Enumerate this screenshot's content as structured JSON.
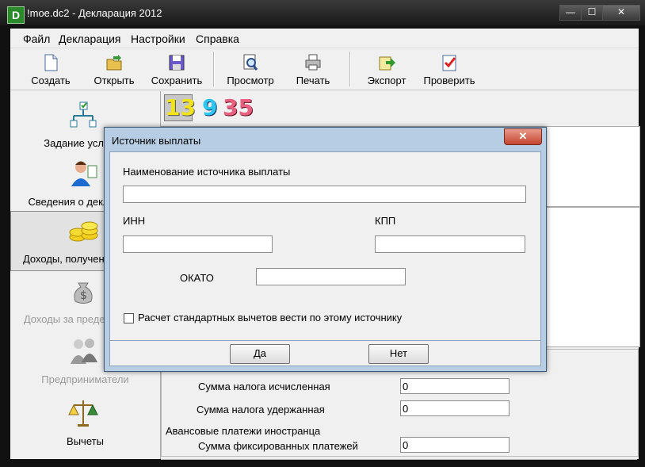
{
  "window": {
    "title": "!moe.dc2 - Декларация 2012",
    "app_icon_letter": "D",
    "min": "—",
    "max": "☐",
    "close": "✕"
  },
  "menu": [
    "Файл",
    "Декларация",
    "Настройки",
    "Справка"
  ],
  "toolbar": [
    {
      "label": "Создать",
      "icon": "new-document-icon"
    },
    {
      "label": "Открыть",
      "icon": "open-folder-icon"
    },
    {
      "label": "Сохранить",
      "icon": "floppy-disk-icon"
    },
    {
      "label": "Просмотр",
      "icon": "magnifier-icon"
    },
    {
      "label": "Печать",
      "icon": "printer-icon"
    },
    {
      "label": "Экспорт",
      "icon": "export-icon"
    },
    {
      "label": "Проверить",
      "icon": "checklist-icon"
    }
  ],
  "sidebar": [
    {
      "label": "Задание условий",
      "icon": "tree-diagram-icon",
      "active": false,
      "disabled": false
    },
    {
      "label": "Сведения о декларанте",
      "icon": "person-icon",
      "active": false,
      "disabled": false
    },
    {
      "label": "Доходы, полученные в РФ",
      "icon": "coins-icon",
      "active": true,
      "disabled": false
    },
    {
      "label": "Доходы за пределами РФ",
      "icon": "money-bag-icon",
      "active": false,
      "disabled": true
    },
    {
      "label": "Предприниматели",
      "icon": "businessmen-icon",
      "active": false,
      "disabled": true
    },
    {
      "label": "Вычеты",
      "icon": "scales-icon",
      "active": false,
      "disabled": false
    }
  ],
  "tax_rates": {
    "r13": "13",
    "r9": "9",
    "r35": "35"
  },
  "content": {
    "sum_calculated_label": "Сумма налога исчисленная",
    "sum_calculated_value": "0",
    "sum_withheld_label": "Сумма налога удержанная",
    "sum_withheld_value": "0",
    "advance_group_title": "Авансовые платежи иностранца",
    "fixed_payments_label": "Сумма фиксированных платежей",
    "fixed_payments_value": "0"
  },
  "dialog": {
    "title": "Источник выплаты",
    "close": "✕",
    "name_label": "Наименование источника выплаты",
    "name_value": "",
    "inn_label": "ИНН",
    "inn_value": "",
    "kpp_label": "КПП",
    "kpp_value": "",
    "okato_label": "ОКАТО",
    "okato_value": "",
    "std_deductions_label": "Расчет стандартных вычетов вести по этому источнику",
    "std_deductions_checked": false,
    "yes_button": "Да",
    "no_button": "Нет"
  }
}
